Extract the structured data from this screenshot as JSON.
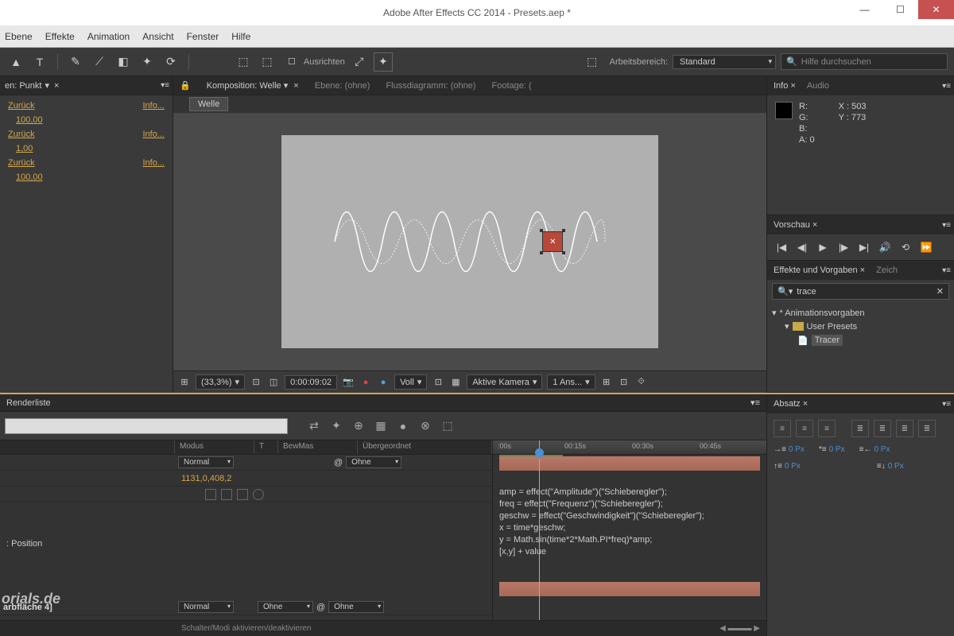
{
  "window": {
    "title": "Adobe After Effects CC 2014 - Presets.aep *"
  },
  "menubar": [
    "Ebene",
    "Effekte",
    "Animation",
    "Ansicht",
    "Fenster",
    "Hilfe"
  ],
  "toolbar": {
    "ausrichten": "Ausrichten",
    "arbeitsbereich_label": "Arbeitsbereich:",
    "arbeitsbereich_value": "Standard",
    "search_placeholder": "Hilfe durchsuchen"
  },
  "left_panel": {
    "tab": "en: Punkt",
    "history": [
      {
        "label": "Zurück",
        "action": "Info..."
      },
      {
        "value": "100,00"
      },
      {
        "label": "Zurück",
        "action": "Info..."
      },
      {
        "value": "1,00"
      },
      {
        "label": "Zurück",
        "action": "Info..."
      },
      {
        "value": "100,00"
      }
    ]
  },
  "comp": {
    "tabs": [
      "Komposition: Welle",
      "Ebene: (ohne)",
      "Flussdiagramm: (ohne)",
      "Footage: ("
    ],
    "breadcrumb": "Welle",
    "footer": {
      "zoom": "(33,3%)",
      "timecode": "0:00:09:02",
      "resolution": "Voll",
      "camera": "Aktive Kamera",
      "views": "1 Ans..."
    }
  },
  "info_panel": {
    "tabs": [
      "Info",
      "Audio"
    ],
    "rgba": {
      "r": "R:",
      "g": "G:",
      "b": "B:",
      "a": "A:   0"
    },
    "pos": {
      "x": "X : 503",
      "y": "Y : 773"
    }
  },
  "preview": {
    "title": "Vorschau"
  },
  "effects": {
    "title": "Effekte und Vorgaben",
    "tab2": "Zeich",
    "search": "trace",
    "tree": {
      "root": "* Animationsvorgaben",
      "folder": "User Presets",
      "item": "Tracer"
    }
  },
  "timeline": {
    "tab": "Renderliste",
    "headers": {
      "modus": "Modus",
      "t": "T",
      "bewmas": "BewMas",
      "uber": "Übergeordnet"
    },
    "row1": {
      "mode": "Normal",
      "parent": "Ohne"
    },
    "value": "1131,0,408,2",
    "position_label": ": Position",
    "row2": {
      "mode": "Normal",
      "track": "Ohne",
      "parent": "Ohne"
    },
    "layer2": "arbfläche 4]",
    "expression": [
      "amp = effect(\"Amplitude\")(\"Schieberegler\");",
      "freq = effect(\"Frequenz\")(\"Schieberegler\");",
      "geschw = effect(\"Geschwindigkeit\")(\"Schieberegler\");",
      "",
      "x = time*geschw;",
      "y = Math.sin(time*2*Math.PI*freq)*amp;",
      "[x,y] + value"
    ],
    "timecodes": [
      ":00s",
      "00:15s",
      "00:30s",
      "00:45s"
    ],
    "footer": "Schalter/Modi aktivieren/deaktivieren"
  },
  "paragraph": {
    "title": "Absatz",
    "px": "0 Px"
  },
  "watermark": "orials.de"
}
